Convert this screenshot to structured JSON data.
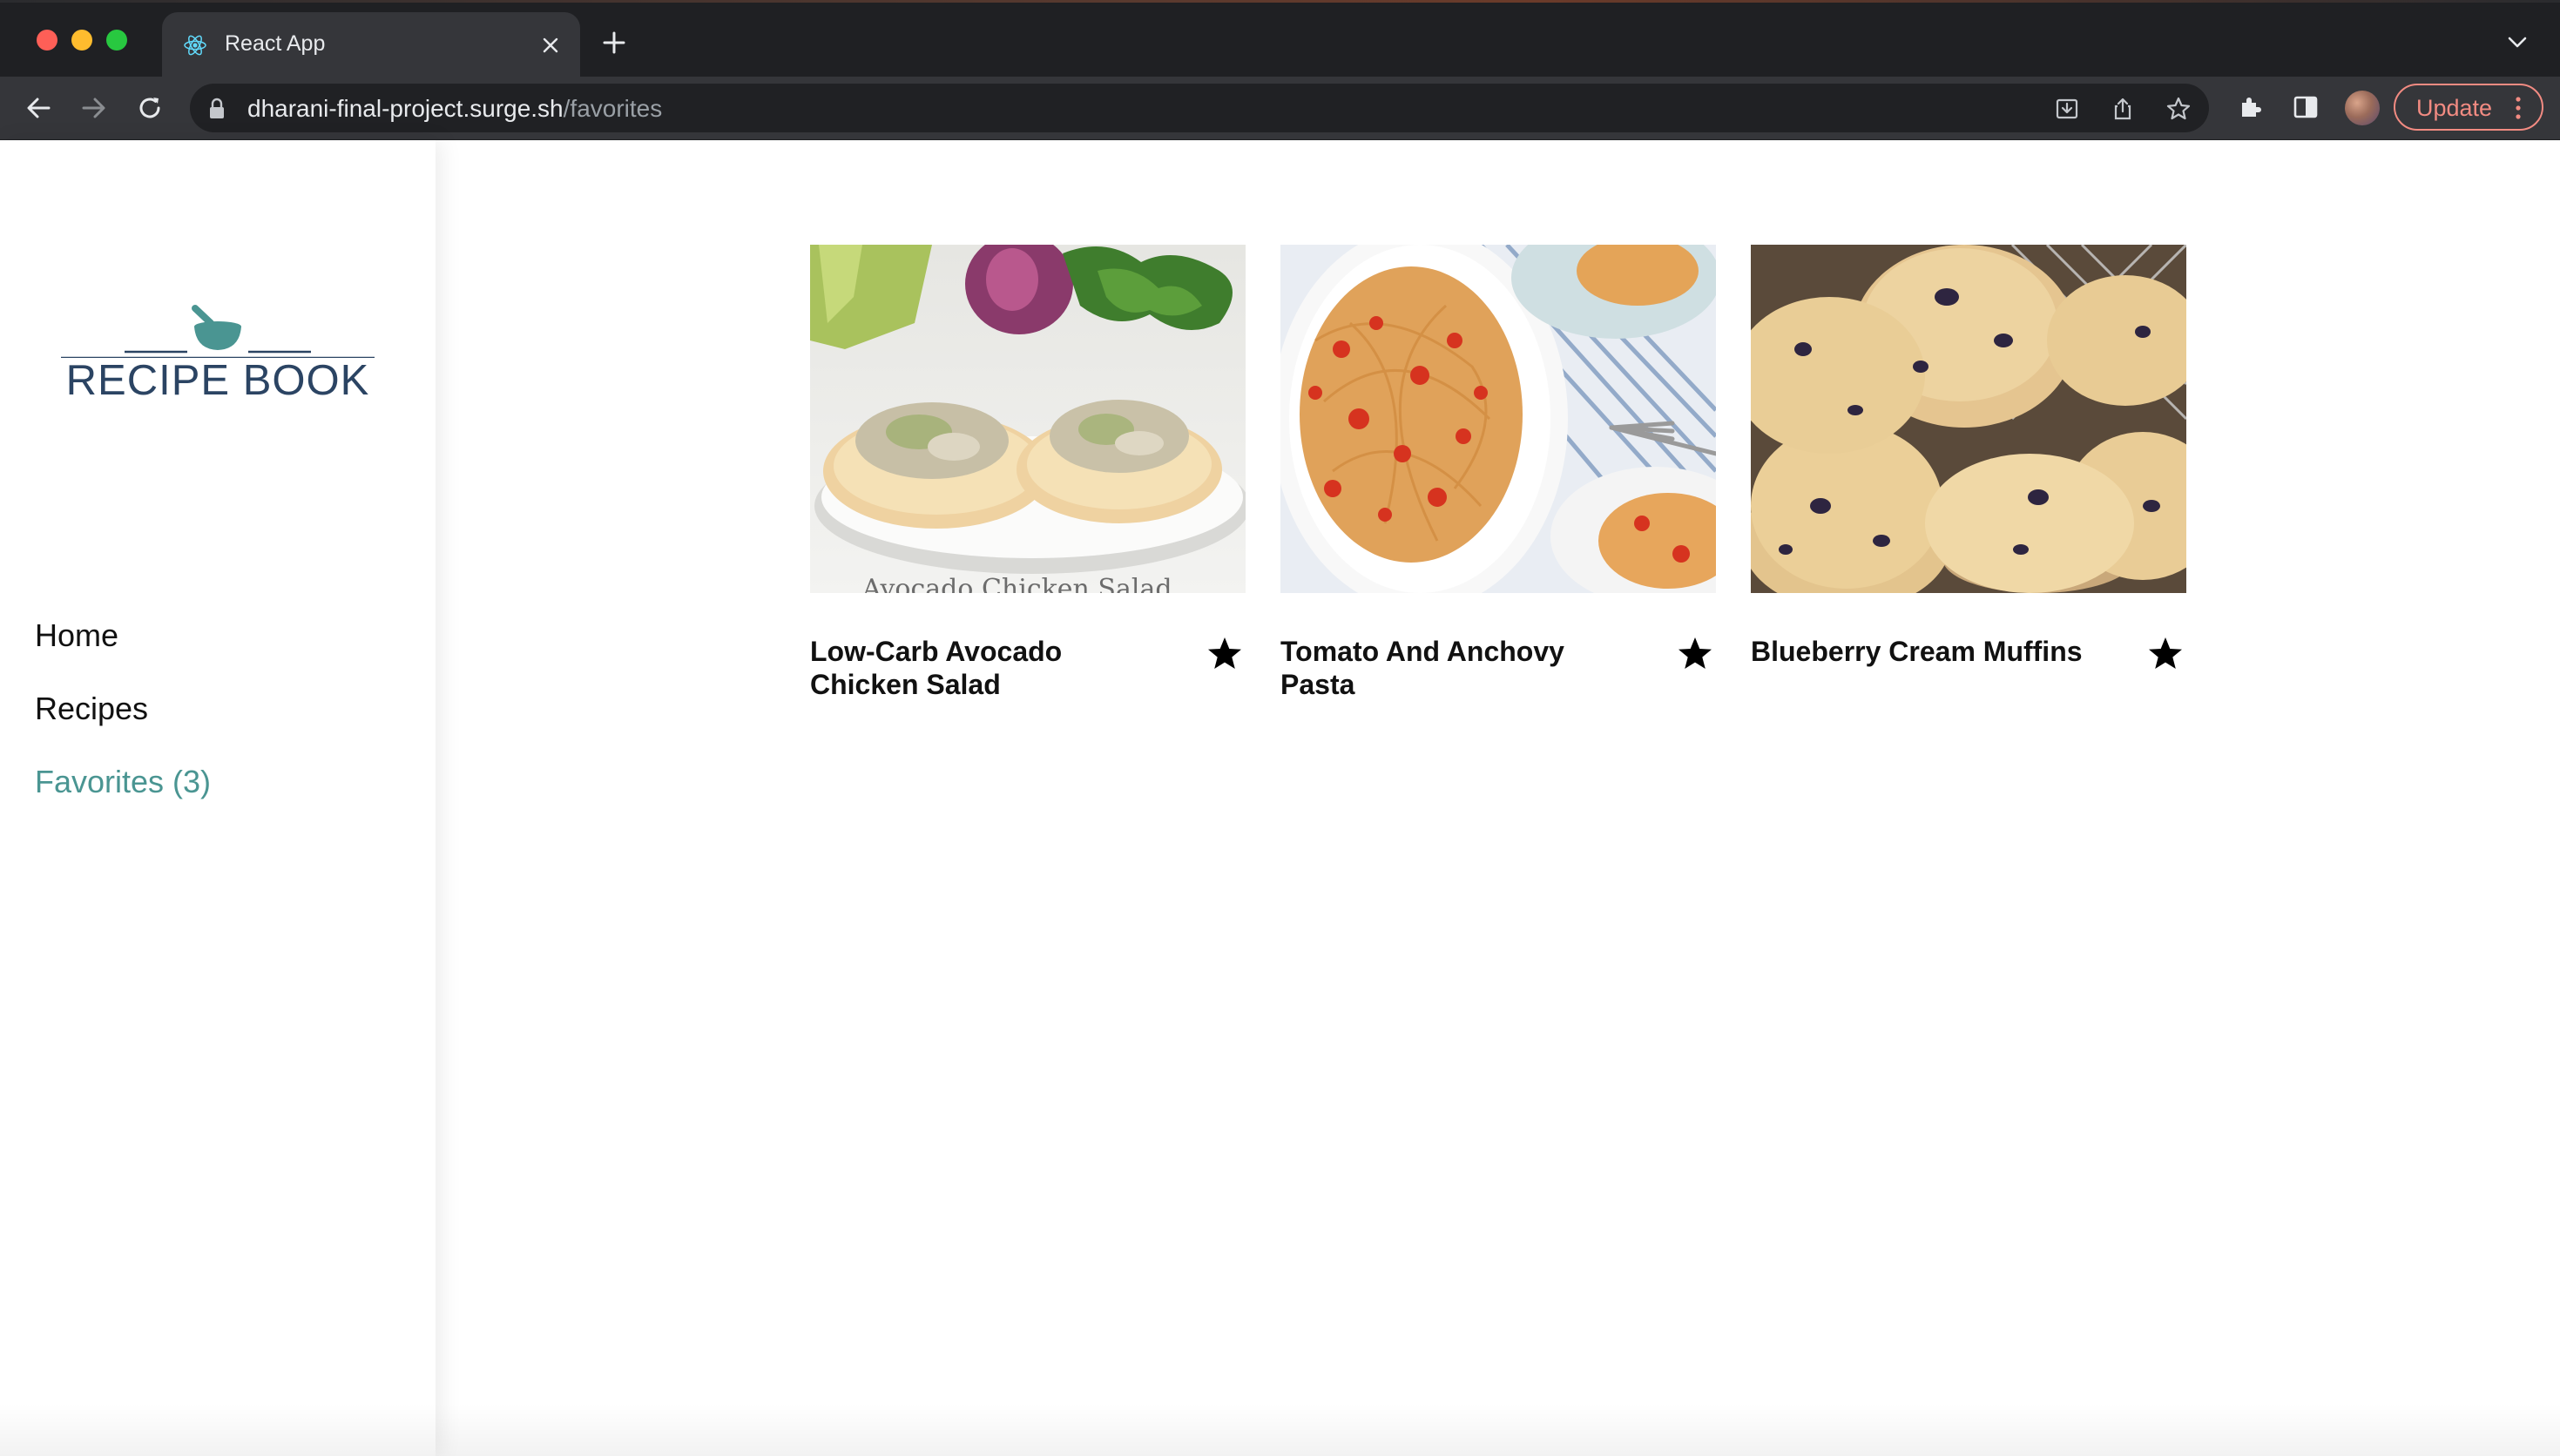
{
  "browser": {
    "tab_title": "React App",
    "url_host": "dharani-final-project.surge.sh",
    "url_path": "/favorites",
    "update_label": "Update"
  },
  "sidebar": {
    "logo_text": "RECIPE BOOK",
    "nav": [
      {
        "label": "Home"
      },
      {
        "label": "Recipes"
      },
      {
        "label": "Favorites (3)"
      }
    ]
  },
  "favorites": [
    {
      "title": "Low-Carb Avocado Chicken Salad",
      "favorited": true
    },
    {
      "title": "Tomato And Anchovy Pasta",
      "favorited": true
    },
    {
      "title": "Blueberry Cream Muffins",
      "favorited": true
    }
  ],
  "colors": {
    "accent": "#4a9592",
    "logo": "#2b4463",
    "update": "#f28b82"
  }
}
